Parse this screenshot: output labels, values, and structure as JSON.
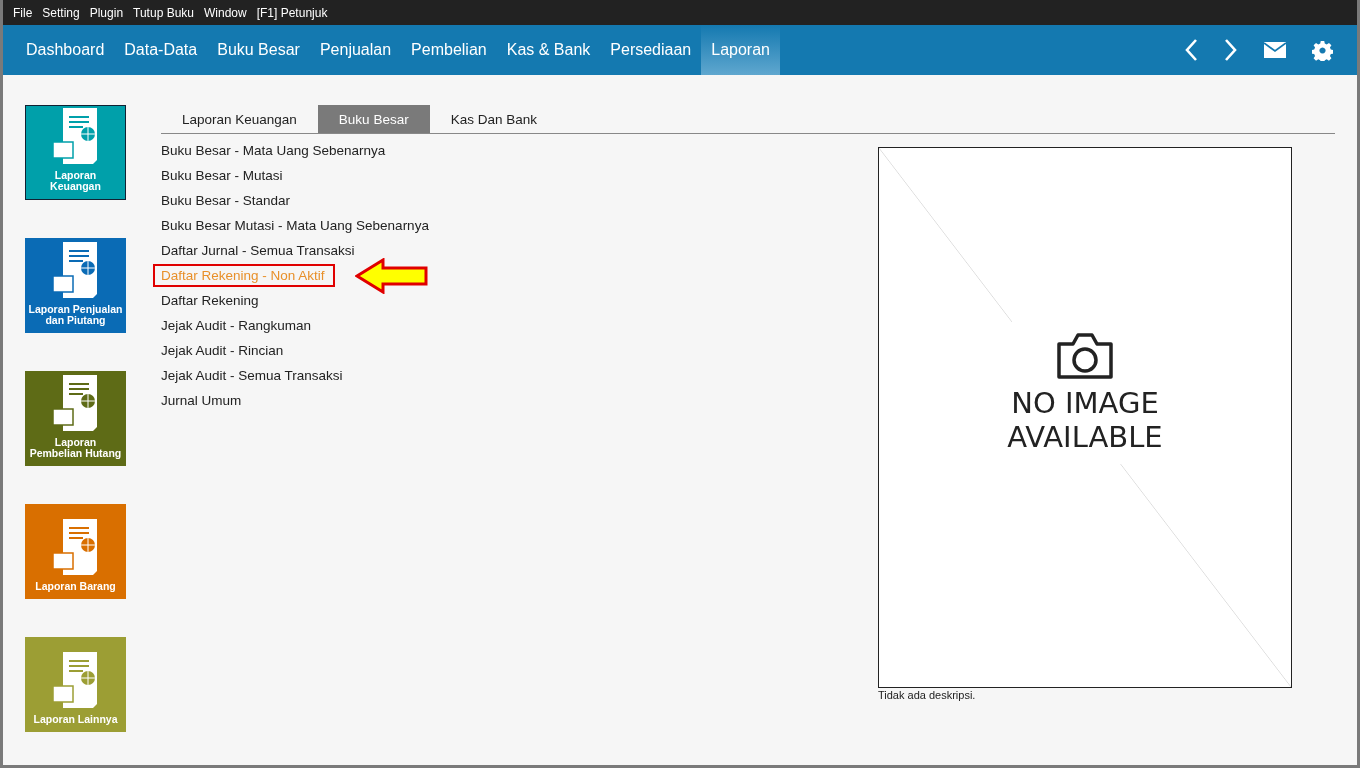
{
  "menu_bar": [
    "File",
    "Setting",
    "Plugin",
    "Tutup Buku",
    "Window",
    "[F1] Petunjuk"
  ],
  "nav_tabs": [
    {
      "label": "Dashboard",
      "selected": false
    },
    {
      "label": "Data-Data",
      "selected": false
    },
    {
      "label": "Buku Besar",
      "selected": false
    },
    {
      "label": "Penjualan",
      "selected": false
    },
    {
      "label": "Pembelian",
      "selected": false
    },
    {
      "label": "Kas & Bank",
      "selected": false
    },
    {
      "label": "Persediaan",
      "selected": false
    },
    {
      "label": "Laporan",
      "selected": true
    }
  ],
  "report_categories": [
    {
      "label": "Laporan\nKeuangan",
      "color": "#00a0aa",
      "selected": true
    },
    {
      "label": "Laporan Penjualan dan Piutang",
      "color": "#0a6bb5",
      "selected": false
    },
    {
      "label": "Laporan\nPembelian Hutang",
      "color": "#5e6b16",
      "selected": false
    },
    {
      "label": "Laporan Barang",
      "color": "#d96f00",
      "selected": false
    },
    {
      "label": "Laporan Lainnya",
      "color": "#9c9e34",
      "selected": false
    }
  ],
  "sub_tabs": [
    {
      "label": "Laporan Keuangan",
      "selected": false
    },
    {
      "label": "Buku Besar",
      "selected": true
    },
    {
      "label": "Kas Dan Bank",
      "selected": false
    }
  ],
  "reports": [
    {
      "label": "Buku Besar - Mata Uang Sebenarnya",
      "selected": false
    },
    {
      "label": "Buku Besar - Mutasi",
      "selected": false
    },
    {
      "label": "Buku Besar - Standar",
      "selected": false
    },
    {
      "label": "Buku Besar Mutasi - Mata Uang Sebenarnya",
      "selected": false
    },
    {
      "label": "Daftar Jurnal - Semua Transaksi",
      "selected": false
    },
    {
      "label": "Daftar Rekening - Non Aktif",
      "selected": true
    },
    {
      "label": "Daftar Rekening",
      "selected": false
    },
    {
      "label": "Jejak Audit - Rangkuman",
      "selected": false
    },
    {
      "label": "Jejak Audit - Rincian",
      "selected": false
    },
    {
      "label": "Jejak Audit - Semua Transaksi",
      "selected": false
    },
    {
      "label": "Jurnal Umum",
      "selected": false
    }
  ],
  "preview": {
    "placeholder_lines": [
      "NO IMAGE",
      "AVAILABLE"
    ],
    "description": "Tidak ada deskripsi."
  }
}
